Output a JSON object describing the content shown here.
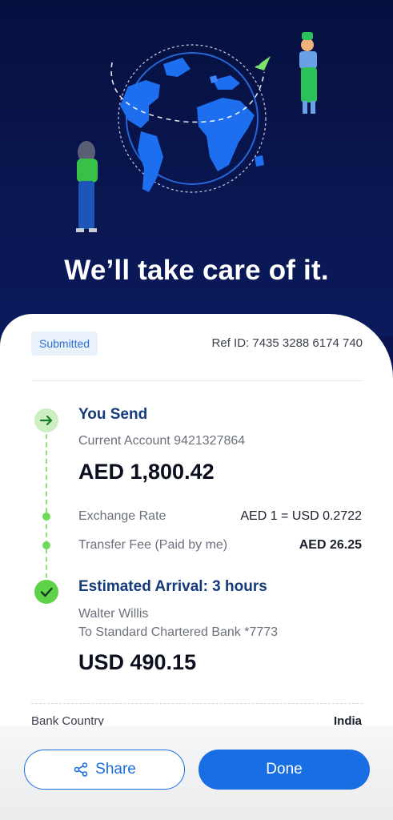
{
  "hero": {
    "headline": "We’ll take care of it."
  },
  "status": {
    "badge": "Submitted",
    "ref": "Ref ID: 7435 3288 6174 740"
  },
  "send": {
    "title": "You Send",
    "account": "Current Account 9421327864",
    "amount": "AED 1,800.42"
  },
  "rate": {
    "exchange_label": "Exchange Rate",
    "exchange_value": "AED 1 = USD 0.2722",
    "fee_label": "Transfer Fee (Paid by me)",
    "fee_value": "AED 26.25"
  },
  "arrival": {
    "title": "Estimated Arrival: 3 hours",
    "recipient": "Walter Willis",
    "bank": "To Standard Chartered Bank *7773",
    "amount": "USD 490.15"
  },
  "details": {
    "bank_country_label": "Bank Country",
    "bank_country_value": "India"
  },
  "actions": {
    "share": "Share",
    "done": "Done"
  },
  "colors": {
    "accent": "#1a6ee3",
    "header_bg": "#0b1a5c",
    "success": "#5ed34a"
  }
}
